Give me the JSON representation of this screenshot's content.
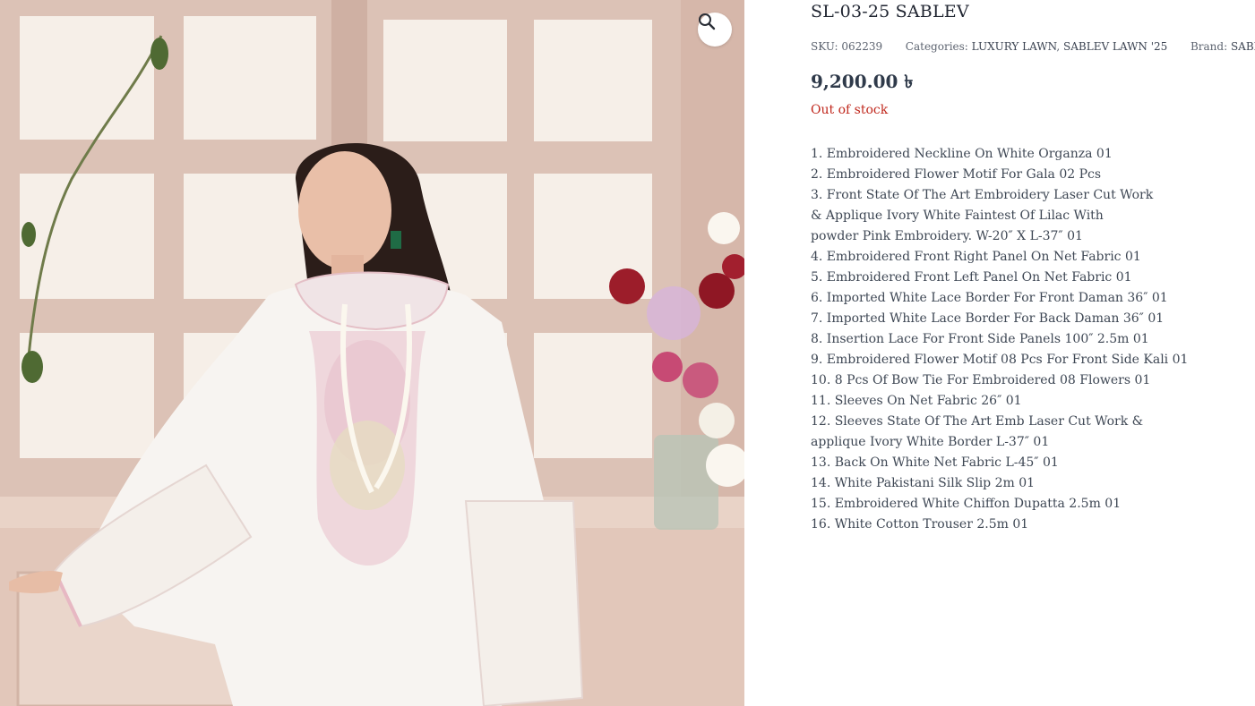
{
  "product": {
    "title": "SL-03-25 SABLEV",
    "sku_label": "SKU:",
    "sku": "062239",
    "categories_label": "Categories:",
    "categories": [
      "LUXURY LAWN",
      "SABLEV LAWN '25"
    ],
    "category_separator": ", ",
    "brand_label": "Brand:",
    "brand": "SABLEV",
    "price": "9,200.00 ৳",
    "stock_status": "Out of stock",
    "description_lines": [
      "1. Embroidered Neckline On White Organza 01",
      "2. Embroidered Flower Motif For Gala 02 Pcs",
      "3. Front State Of The Art Embroidery Laser Cut Work",
      "& Applique Ivory White Faintest Of Lilac With",
      "powder Pink Embroidery. W-20″ X L-37″ 01",
      "4. Embroidered Front Right Panel On Net Fabric 01",
      "5. Embroidered Front Left Panel On Net Fabric 01",
      "6. Imported White Lace Border For Front Daman 36″ 01",
      "7. Imported White Lace Border For Back Daman 36″ 01",
      "8. Insertion Lace For Front Side Panels 100″ 2.5m 01",
      "9. Embroidered Flower Motif 08 Pcs For Front Side Kali 01",
      "10. 8 Pcs Of Bow Tie For Embroidered 08 Flowers 01",
      "11. Sleeves On Net Fabric 26″ 01",
      "12. Sleeves State Of The Art Emb Laser Cut Work &",
      "applique Ivory White Border L-37″ 01",
      "13. Back On White Net Fabric L-45″ 01",
      "14. White Pakistani Silk Slip 2m 01",
      "15. Embroidered White Chiffon Dupatta 2.5m 01",
      "16. White Cotton Trouser 2.5m 01"
    ]
  },
  "gallery": {
    "zoom_icon": "magnifier-icon"
  },
  "colors": {
    "price": "#2f3a4a",
    "out_of_stock": "#c0281d",
    "title": "#1f2430"
  }
}
